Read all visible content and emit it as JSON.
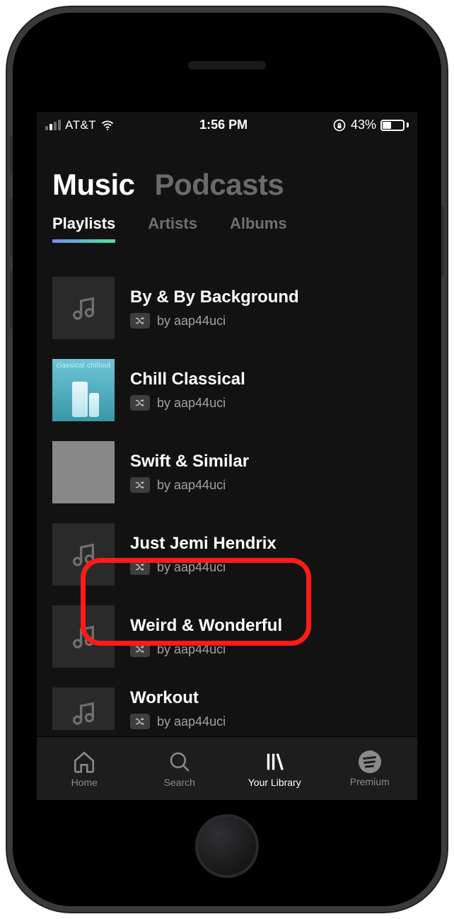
{
  "statusbar": {
    "carrier": "AT&T",
    "time": "1:56 PM",
    "battery_pct": "43%"
  },
  "top_tabs": {
    "music": "Music",
    "podcasts": "Podcasts"
  },
  "sub_tabs": {
    "playlists": "Playlists",
    "artists": "Artists",
    "albums": "Albums"
  },
  "playlists": [
    {
      "title": "By & By Background",
      "by": "by aap44uci",
      "cover": "generic"
    },
    {
      "title": "Chill Classical",
      "by": "by aap44uci",
      "cover": "classical",
      "cover_label": "classical chillout"
    },
    {
      "title": "Swift & Similar",
      "by": "by aap44uci",
      "cover": "swift",
      "highlighted": true
    },
    {
      "title": "Just Jemi Hendrix",
      "by": "by aap44uci",
      "cover": "generic"
    },
    {
      "title": "Weird & Wonderful",
      "by": "by aap44uci",
      "cover": "generic"
    },
    {
      "title": "Workout",
      "by": "by aap44uci",
      "cover": "generic"
    }
  ],
  "nav": {
    "home": "Home",
    "search": "Search",
    "library": "Your Library",
    "premium": "Premium"
  }
}
